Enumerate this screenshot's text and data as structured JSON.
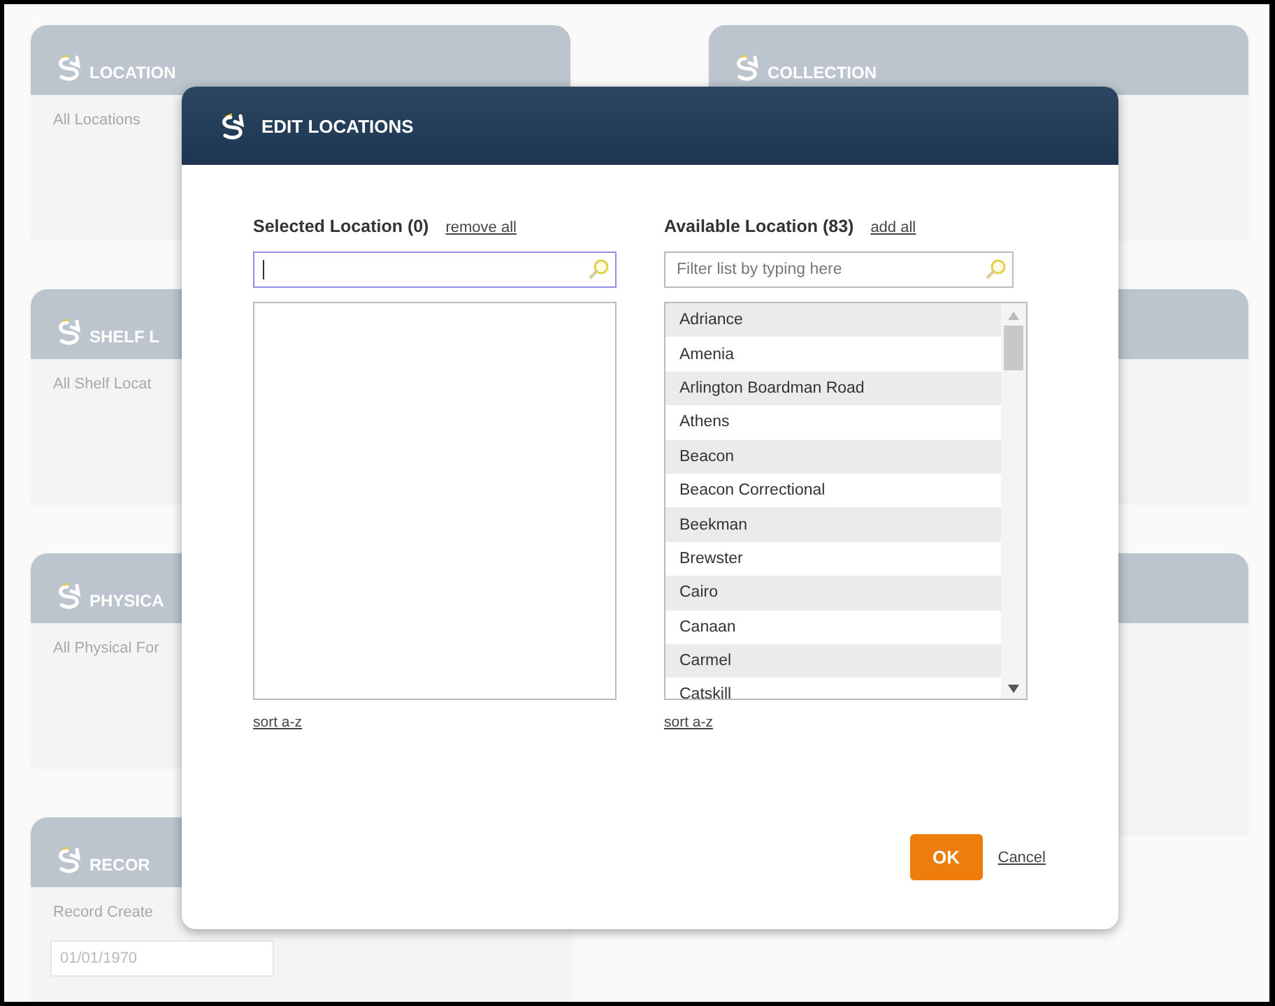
{
  "left_cards": [
    {
      "title": "LOCATION",
      "text": "All Locations"
    },
    {
      "title": "SHELF L",
      "text": "All Shelf Locat"
    },
    {
      "title": "PHYSICA",
      "text": "All Physical For"
    },
    {
      "title": "RECOR",
      "text": "Record Create",
      "field_value": "01/01/1970"
    }
  ],
  "right_cards": [
    {
      "title": "COLLECTION"
    }
  ],
  "dialog": {
    "title": "EDIT LOCATIONS",
    "selected_panel": {
      "heading": "Selected Location (0)",
      "action": "remove all",
      "filter": {
        "focused": true
      },
      "sort": "sort a-z"
    },
    "available_panel": {
      "heading": "Available Location (83)",
      "action": "add all",
      "filter": {
        "placeholder": "Filter list by typing here",
        "focused": false
      },
      "items": [
        "Adriance",
        "Amenia",
        "Arlington Boardman Road",
        "Athens",
        "Beacon",
        "Beacon Correctional",
        "Beekman",
        "Brewster",
        "Cairo",
        "Canaan",
        "Carmel",
        "Catskill"
      ],
      "sort": "sort a-z"
    },
    "buttons": {
      "ok": "OK",
      "cancel": "Cancel"
    }
  }
}
